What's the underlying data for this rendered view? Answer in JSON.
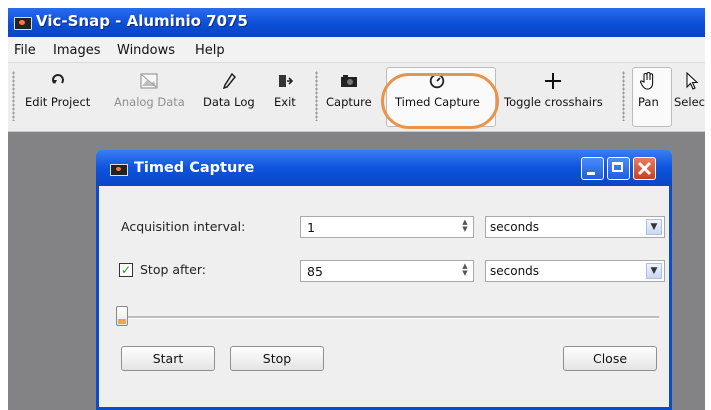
{
  "window": {
    "title": "Vic-Snap - Aluminio 7075"
  },
  "menu": [
    "File",
    "Images",
    "Windows",
    "Help"
  ],
  "toolbar": {
    "edit_project": "Edit Project",
    "analog_data": "Analog Data",
    "data_log": "Data Log",
    "exit": "Exit",
    "capture": "Capture",
    "timed_capture": "Timed Capture",
    "toggle_crosshairs": "Toggle crosshairs",
    "pan": "Pan",
    "select": "Select"
  },
  "dialog": {
    "title": "Timed Capture",
    "acq_label": "Acquisition interval:",
    "acq_value": "1",
    "acq_unit": "seconds",
    "stop_label": "Stop after:",
    "stop_checked": true,
    "stop_value": "85",
    "stop_unit": "seconds",
    "progress": 0,
    "start": "Start",
    "stop": "Stop",
    "close": "Close"
  },
  "colors": {
    "titlebar": "#0b4fd6",
    "highlight": "#e8944b",
    "workspace": "#838386"
  },
  "icons": [
    "camera-icon",
    "refresh-icon",
    "image-icon",
    "pencil-icon",
    "exit-door-icon",
    "stopwatch-icon",
    "crosshair-icon",
    "hand-icon",
    "cursor-icon",
    "minimize-icon",
    "maximize-icon",
    "close-icon",
    "check-icon"
  ]
}
